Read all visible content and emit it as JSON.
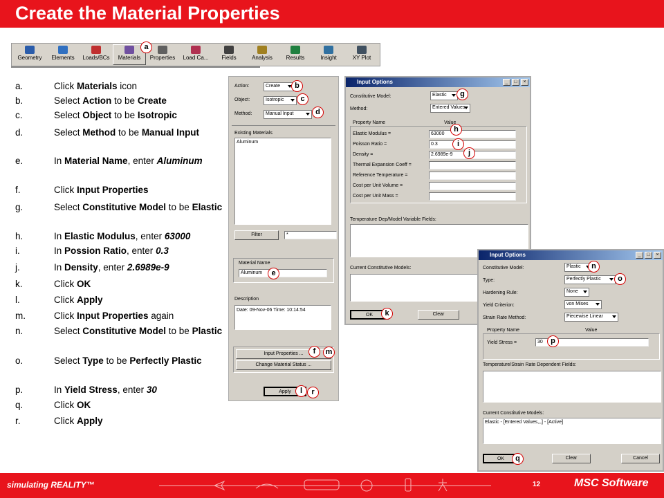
{
  "slide": {
    "title": "Create the Material Properties",
    "page_number": "12",
    "footer_left": "simulating REALITY™",
    "footer_brand": "MSC Software",
    "colors": {
      "red": "#e8141c",
      "title_text": "#ffffff"
    }
  },
  "toolbar": {
    "items": [
      {
        "label": "Geometry",
        "icon": "geometry-icon"
      },
      {
        "label": "Elements",
        "icon": "elements-icon"
      },
      {
        "label": "Loads/BCs",
        "icon": "loads-icon"
      },
      {
        "label": "Materials",
        "icon": "materials-icon"
      },
      {
        "label": "Properties",
        "icon": "properties-icon"
      },
      {
        "label": "Load Ca...",
        "icon": "load-cases-icon"
      },
      {
        "label": "Fields",
        "icon": "fields-icon"
      },
      {
        "label": "Analysis",
        "icon": "analysis-icon"
      },
      {
        "label": "Results",
        "icon": "results-icon"
      },
      {
        "label": "Insight",
        "icon": "insight-icon"
      },
      {
        "label": "XY Plot",
        "icon": "xy-plot-icon"
      }
    ]
  },
  "steps": [
    {
      "key": "a.",
      "parts": [
        "Click ",
        "Materials",
        " icon"
      ]
    },
    {
      "key": "b.",
      "parts": [
        "Select ",
        "Action",
        " to be ",
        "Create"
      ]
    },
    {
      "key": "c.",
      "parts": [
        "Select ",
        "Object",
        " to be ",
        "Isotropic"
      ]
    },
    {
      "key": "d.",
      "parts": [
        "Select ",
        "Method",
        " to be ",
        "Manual Input"
      ]
    },
    {
      "key": "e.",
      "parts": [
        "In ",
        "Material Name",
        ", enter ",
        "Aluminum"
      ]
    },
    {
      "key": "f.",
      "parts": [
        "Click ",
        "Input Properties"
      ]
    },
    {
      "key": "g.",
      "parts": [
        "Select ",
        "Constitutive Model",
        " to be ",
        "Elastic"
      ]
    },
    {
      "key": "h.",
      "parts": [
        "In ",
        "Elastic Modulus",
        ", enter ",
        "63000"
      ]
    },
    {
      "key": "i.",
      "parts": [
        "In ",
        "Possion Ratio",
        ", enter ",
        "0.3"
      ]
    },
    {
      "key": "j.",
      "parts": [
        "In ",
        "Density",
        ", enter ",
        "2.6989e-9"
      ]
    },
    {
      "key": "k.",
      "parts": [
        "Click ",
        "OK"
      ]
    },
    {
      "key": "l.",
      "parts": [
        "Click ",
        "Apply"
      ]
    },
    {
      "key": "m.",
      "parts": [
        "Click ",
        "Input Properties",
        " again"
      ]
    },
    {
      "key": "n.",
      "parts": [
        "Select ",
        "Constitutive Model",
        " to be ",
        "Plastic"
      ]
    },
    {
      "key": "o.",
      "parts": [
        "Select ",
        "Type",
        " to be ",
        "Perfectly Plastic"
      ]
    },
    {
      "key": "p.",
      "parts": [
        "In ",
        "Yield Stress",
        ", enter ",
        "30"
      ]
    },
    {
      "key": "q.",
      "parts": [
        "Click ",
        "OK"
      ]
    },
    {
      "key": "r.",
      "parts": [
        "Click ",
        "Apply"
      ]
    }
  ],
  "materials_panel": {
    "action_label": "Action:",
    "action_value": "Create",
    "object_label": "Object:",
    "object_value": "Isotropic",
    "method_label": "Method:",
    "method_value": "Manual Input",
    "existing_label": "Existing Materials",
    "existing_items": [
      "Aluminum"
    ],
    "filter_button": "Filter",
    "filter_value": "*",
    "name_label": "Material Name",
    "name_value": "Aluminum",
    "description_label": "Description",
    "description_text": "Date: 09-Nov-06       Time: 10:14:54",
    "input_props_button": "Input Properties ...",
    "change_status_button": "Change Material Status ...",
    "apply_button": "Apply"
  },
  "input_options_1": {
    "title": "Input Options",
    "model_label": "Constitutive Model:",
    "model_value": "Elastic",
    "method_label": "Method:",
    "method_value": "Entered Values",
    "col_name": "Property Name",
    "col_value": "Value",
    "rows": [
      {
        "name": "Elastic Modulus =",
        "value": "63000"
      },
      {
        "name": "Poisson Ratio =",
        "value": "0.3"
      },
      {
        "name": "Density =",
        "value": "2.6989e-9"
      },
      {
        "name": "Thermal Expansion Coeff =",
        "value": ""
      },
      {
        "name": "Reference Temperature =",
        "value": ""
      },
      {
        "name": "Cost per Unit Volume =",
        "value": ""
      },
      {
        "name": "Cost per Unit Mass =",
        "value": ""
      }
    ],
    "temp_label": "Temperature Dep/Model Variable Fields:",
    "current_label": "Current Constitutive Models:",
    "ok_button": "OK",
    "clear_button": "Clear"
  },
  "input_options_2": {
    "title": "Input Options",
    "model_label": "Constitutive Model:",
    "model_value": "Plastic",
    "type_label": "Type:",
    "type_value": "Perfectly Plastic",
    "hardening_label": "Hardening Rule:",
    "hardening_value": "None",
    "yield_label": "Yield Criterion:",
    "yield_value": "von Mises",
    "strain_label": "Strain Rate Method:",
    "strain_value": "Piecewise Linear",
    "col_name": "Property Name",
    "col_value": "Value",
    "stress_label": "Yield Stress =",
    "stress_value": "30",
    "temp_label": "Temperature/Strain Rate Dependent Fields:",
    "current_label": "Current Constitutive Models:",
    "current_value": "Elastic - [Entered Values,,,] - [Active]",
    "ok_button": "OK",
    "clear_button": "Clear",
    "cancel_button": "Cancel"
  },
  "callouts": [
    "a",
    "b",
    "c",
    "d",
    "e",
    "f",
    "g",
    "h",
    "i",
    "j",
    "k",
    "l",
    "m",
    "n",
    "o",
    "p",
    "q",
    "r"
  ]
}
